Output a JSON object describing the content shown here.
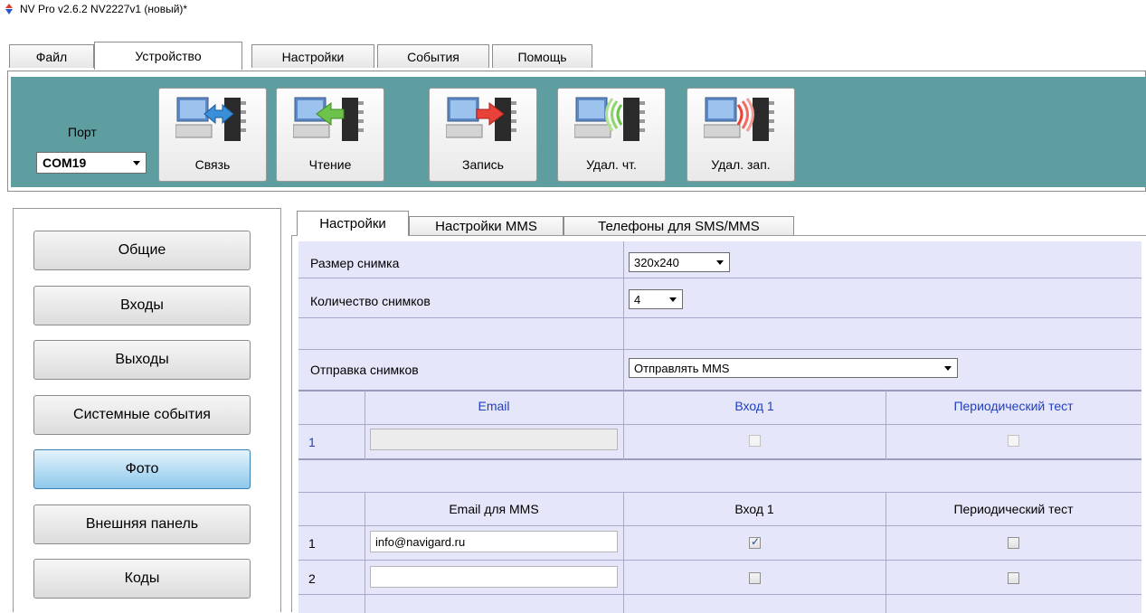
{
  "window": {
    "title": "NV Pro v2.6.2 NV2227v1 (новый)*"
  },
  "menu": {
    "tabs": [
      {
        "label": "Файл"
      },
      {
        "label": "Устройство"
      },
      {
        "label": "Настройки"
      },
      {
        "label": "События"
      },
      {
        "label": "Помощь"
      }
    ],
    "active": "Устройство"
  },
  "toolbar": {
    "port_label": "Порт",
    "port_value": "COM19",
    "buttons": [
      {
        "label": "Связь"
      },
      {
        "label": "Чтение"
      },
      {
        "label": "Запись"
      },
      {
        "label": "Удал. чт."
      },
      {
        "label": "Удал. зап."
      }
    ]
  },
  "sidebar": {
    "items": [
      {
        "label": "Общие"
      },
      {
        "label": "Входы"
      },
      {
        "label": "Выходы"
      },
      {
        "label": "Системные события"
      },
      {
        "label": "Фото"
      },
      {
        "label": "Внешняя панель"
      },
      {
        "label": "Коды"
      }
    ],
    "active": "Фото"
  },
  "subtabs": {
    "items": [
      {
        "label": "Настройки"
      },
      {
        "label": "Настройки MMS"
      },
      {
        "label": "Телефоны для SMS/MMS"
      }
    ],
    "active": "Настройки"
  },
  "settings": {
    "photo_size": {
      "label": "Размер снимка",
      "value": "320x240"
    },
    "photo_count": {
      "label": "Количество снимков",
      "value": "4"
    },
    "photo_send": {
      "label": "Отправка снимков",
      "value": "Отправлять MMS"
    }
  },
  "email_table": {
    "headers": [
      "Email",
      "Вход 1",
      "Периодический тест"
    ],
    "rows": [
      {
        "num": "1",
        "email": "",
        "input1": false,
        "periodic": false
      }
    ]
  },
  "mms_table": {
    "headers": [
      "Email для MMS",
      "Вход 1",
      "Периодический тест"
    ],
    "rows": [
      {
        "num": "1",
        "email": "info@navigard.ru",
        "input1": true,
        "periodic": false
      },
      {
        "num": "2",
        "email": "",
        "input1": false,
        "periodic": false
      }
    ]
  },
  "colors": {
    "toolbar_bg": "#5f9ea0",
    "grid_bg": "#e6e6fa",
    "header_text": "#1f3fbf",
    "active_nav": "#b4dcf3"
  }
}
